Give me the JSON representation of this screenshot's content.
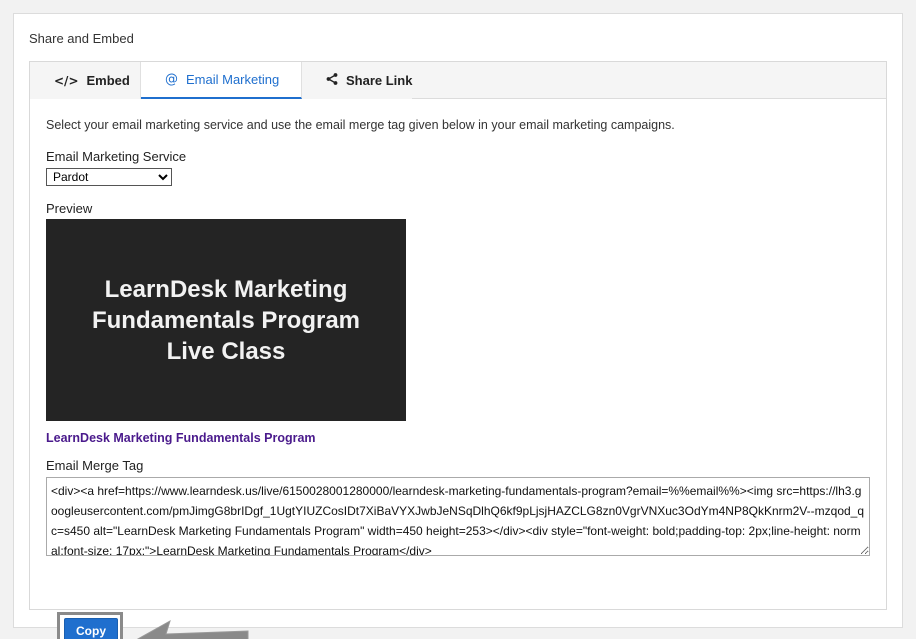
{
  "section_title": "Share and Embed",
  "tabs": [
    {
      "label": "Embed",
      "icon": "code-icon",
      "glyph": "</>",
      "active": false
    },
    {
      "label": "Email Marketing",
      "icon": "at-icon",
      "glyph": "@",
      "active": true
    },
    {
      "label": "Share Link",
      "icon": "share-icon",
      "glyph": "",
      "active": false
    }
  ],
  "intro_text": "Select your email marketing service and use the email merge tag given below in your email marketing campaigns.",
  "service": {
    "label": "Email Marketing Service",
    "selected": "Pardot"
  },
  "preview": {
    "label": "Preview",
    "image_text": "LearnDesk Marketing Fundamentals Program Live Class",
    "link_text": "LearnDesk Marketing Fundamentals Program"
  },
  "merge_tag": {
    "label": "Email Merge Tag",
    "value": "<div><a href=https://www.learndesk.us/live/6150028001280000/learndesk-marketing-fundamentals-program?email=%%email%%><img src=https://lh3.googleusercontent.com/pmJimgG8brIDgf_1UgtYIUZCosIDt7XiBaVYXJwbJeNSqDlhQ6kf9pLjsjHAZCLG8zn0VgrVNXuc3OdYm4NP8QkKnrm2V--mzqod_qc=s450 alt=\"LearnDesk Marketing Fundamentals Program\" width=450 height=253></div><div style=\"font-weight: bold;padding-top: 2px;line-height: normal;font-size: 17px;\">LearnDesk Marketing Fundamentals Program</div>"
  },
  "copy_button": {
    "label": "Copy"
  },
  "colors": {
    "accent": "#1f6fce",
    "link": "#4a1a8c",
    "preview_bg": "#242424",
    "highlight_border": "#8a8a8a"
  }
}
